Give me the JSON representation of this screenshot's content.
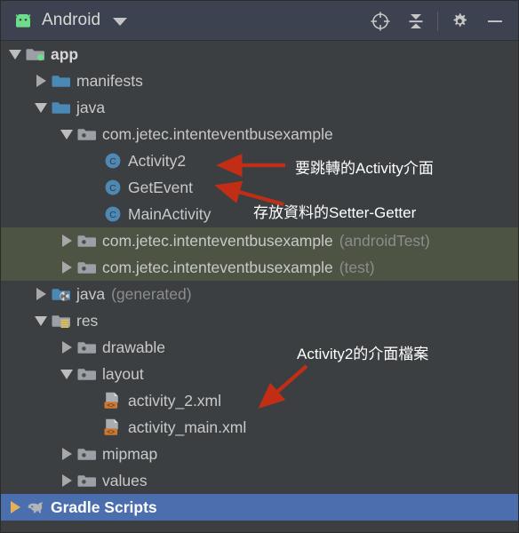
{
  "window": {
    "title": "Android",
    "logo_icon": "android-robot-icon",
    "dropdown_icon": "chevron-down-icon"
  },
  "toolbar": {
    "buttons": [
      {
        "name": "select-opened-file-button",
        "icon": "crosshair-target-icon",
        "tooltip": "Select Opened File"
      },
      {
        "name": "collapse-all-button",
        "icon": "collapse-all-icon",
        "tooltip": "Collapse All"
      },
      {
        "name": "settings-button",
        "icon": "gear-icon",
        "tooltip": "Settings"
      },
      {
        "name": "hide-button",
        "icon": "minus-icon",
        "tooltip": "Hide"
      }
    ]
  },
  "colors": {
    "header_bg": "#3c4250",
    "panel_bg": "#3c3f41",
    "test_row_highlight": "#4e5444",
    "selected_row": "#4b6eaf",
    "annotation_red": "#c22d15",
    "android_green": "#6fdc8c",
    "folder_blue": "#4a88b5",
    "folder_grey": "#9aa0a6",
    "class_icon_blue": "#4f88b3",
    "xml_badge_orange": "#cc7832",
    "res_badge_yellow": "#e8c44a"
  },
  "tree": {
    "rows": [
      {
        "id": "app",
        "indent": 0,
        "twisty": "down",
        "icon": "folder-module-icon",
        "label": "app",
        "suffix": "",
        "bold": true,
        "state": "normal"
      },
      {
        "id": "manifests",
        "indent": 1,
        "twisty": "right",
        "icon": "folder-blue-icon",
        "label": "manifests",
        "suffix": "",
        "bold": false,
        "state": "normal"
      },
      {
        "id": "java",
        "indent": 1,
        "twisty": "down",
        "icon": "folder-blue-icon",
        "label": "java",
        "suffix": "",
        "bold": false,
        "state": "normal"
      },
      {
        "id": "package-main",
        "indent": 2,
        "twisty": "down",
        "icon": "folder-package-icon",
        "label": "com.jetec.intenteventbusexample",
        "suffix": "",
        "bold": false,
        "state": "normal"
      },
      {
        "id": "activity2",
        "indent": 3,
        "twisty": "none",
        "icon": "java-class-icon",
        "label": "Activity2",
        "suffix": "",
        "bold": false,
        "state": "normal"
      },
      {
        "id": "getevent",
        "indent": 3,
        "twisty": "none",
        "icon": "java-class-icon",
        "label": "GetEvent",
        "suffix": "",
        "bold": false,
        "state": "normal"
      },
      {
        "id": "mainactivity",
        "indent": 3,
        "twisty": "none",
        "icon": "java-class-icon",
        "label": "MainActivity",
        "suffix": "",
        "bold": false,
        "state": "normal"
      },
      {
        "id": "package-androidtest",
        "indent": 2,
        "twisty": "right",
        "icon": "folder-package-icon",
        "label": "com.jetec.intenteventbusexample",
        "suffix": "(androidTest)",
        "bold": false,
        "state": "test-highlight"
      },
      {
        "id": "package-test",
        "indent": 2,
        "twisty": "right",
        "icon": "folder-package-icon",
        "label": "com.jetec.intenteventbusexample",
        "suffix": "(test)",
        "bold": false,
        "state": "test-highlight"
      },
      {
        "id": "java-generated",
        "indent": 1,
        "twisty": "right",
        "icon": "folder-generated-icon",
        "label": "java",
        "suffix": "(generated)",
        "bold": false,
        "state": "normal"
      },
      {
        "id": "res",
        "indent": 1,
        "twisty": "down",
        "icon": "folder-res-icon",
        "label": "res",
        "suffix": "",
        "bold": false,
        "state": "normal"
      },
      {
        "id": "drawable",
        "indent": 2,
        "twisty": "right",
        "icon": "folder-package-icon",
        "label": "drawable",
        "suffix": "",
        "bold": false,
        "state": "normal"
      },
      {
        "id": "layout",
        "indent": 2,
        "twisty": "down",
        "icon": "folder-package-icon",
        "label": "layout",
        "suffix": "",
        "bold": false,
        "state": "normal"
      },
      {
        "id": "activity-2-xml",
        "indent": 3,
        "twisty": "none",
        "icon": "xml-layout-file-icon",
        "label": "activity_2.xml",
        "suffix": "",
        "bold": false,
        "state": "normal"
      },
      {
        "id": "activity-main-xml",
        "indent": 3,
        "twisty": "none",
        "icon": "xml-layout-file-icon",
        "label": "activity_main.xml",
        "suffix": "",
        "bold": false,
        "state": "normal"
      },
      {
        "id": "mipmap",
        "indent": 2,
        "twisty": "right",
        "icon": "folder-package-icon",
        "label": "mipmap",
        "suffix": "",
        "bold": false,
        "state": "normal"
      },
      {
        "id": "values",
        "indent": 2,
        "twisty": "right",
        "icon": "folder-package-icon",
        "label": "values",
        "suffix": "",
        "bold": false,
        "state": "normal"
      },
      {
        "id": "gradle-scripts",
        "indent": 0,
        "twisty": "right",
        "icon": "gradle-elephant-icon",
        "label": "Gradle Scripts",
        "suffix": "",
        "bold": true,
        "state": "selected"
      }
    ]
  },
  "annotations": [
    {
      "id": "anno-activity2",
      "text": "要跳轉的Activity介面",
      "points_to": "activity2"
    },
    {
      "id": "anno-getevent",
      "text": "存放資料的Setter-Getter",
      "points_to": "getevent"
    },
    {
      "id": "anno-layout-xml",
      "text": "Activity2的介面檔案",
      "points_to": "activity-2-xml"
    }
  ]
}
